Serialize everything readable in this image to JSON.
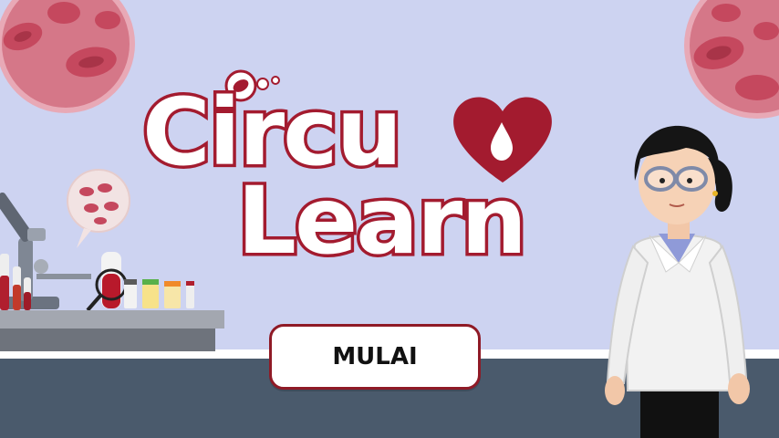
{
  "logo": {
    "line1": "Circu",
    "line2": "Learn"
  },
  "start_button": {
    "label": "MULAI"
  },
  "colors": {
    "background": "#cdd3f1",
    "brand_red": "#a31b2f",
    "floor": "#4a5a6c",
    "button_border": "#8f1a26"
  },
  "icons": [
    "blood-cell-icon",
    "heart-drop-icon",
    "microscope-icon",
    "magnifier-icon"
  ]
}
